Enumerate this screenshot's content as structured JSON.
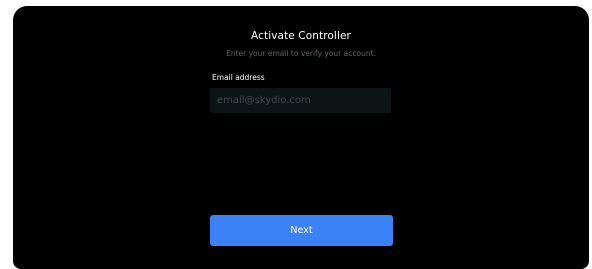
{
  "dialog": {
    "title": "Activate Controller",
    "subtitle": "Enter your email to verify your account.",
    "email_label": "Email address",
    "email_value": "",
    "email_placeholder": "email@skydio.com",
    "next_label": "Next"
  },
  "colors": {
    "background": "#000000",
    "accent": "#3c82f7",
    "input_background": "#0d1416",
    "muted_text": "#5d6467"
  }
}
